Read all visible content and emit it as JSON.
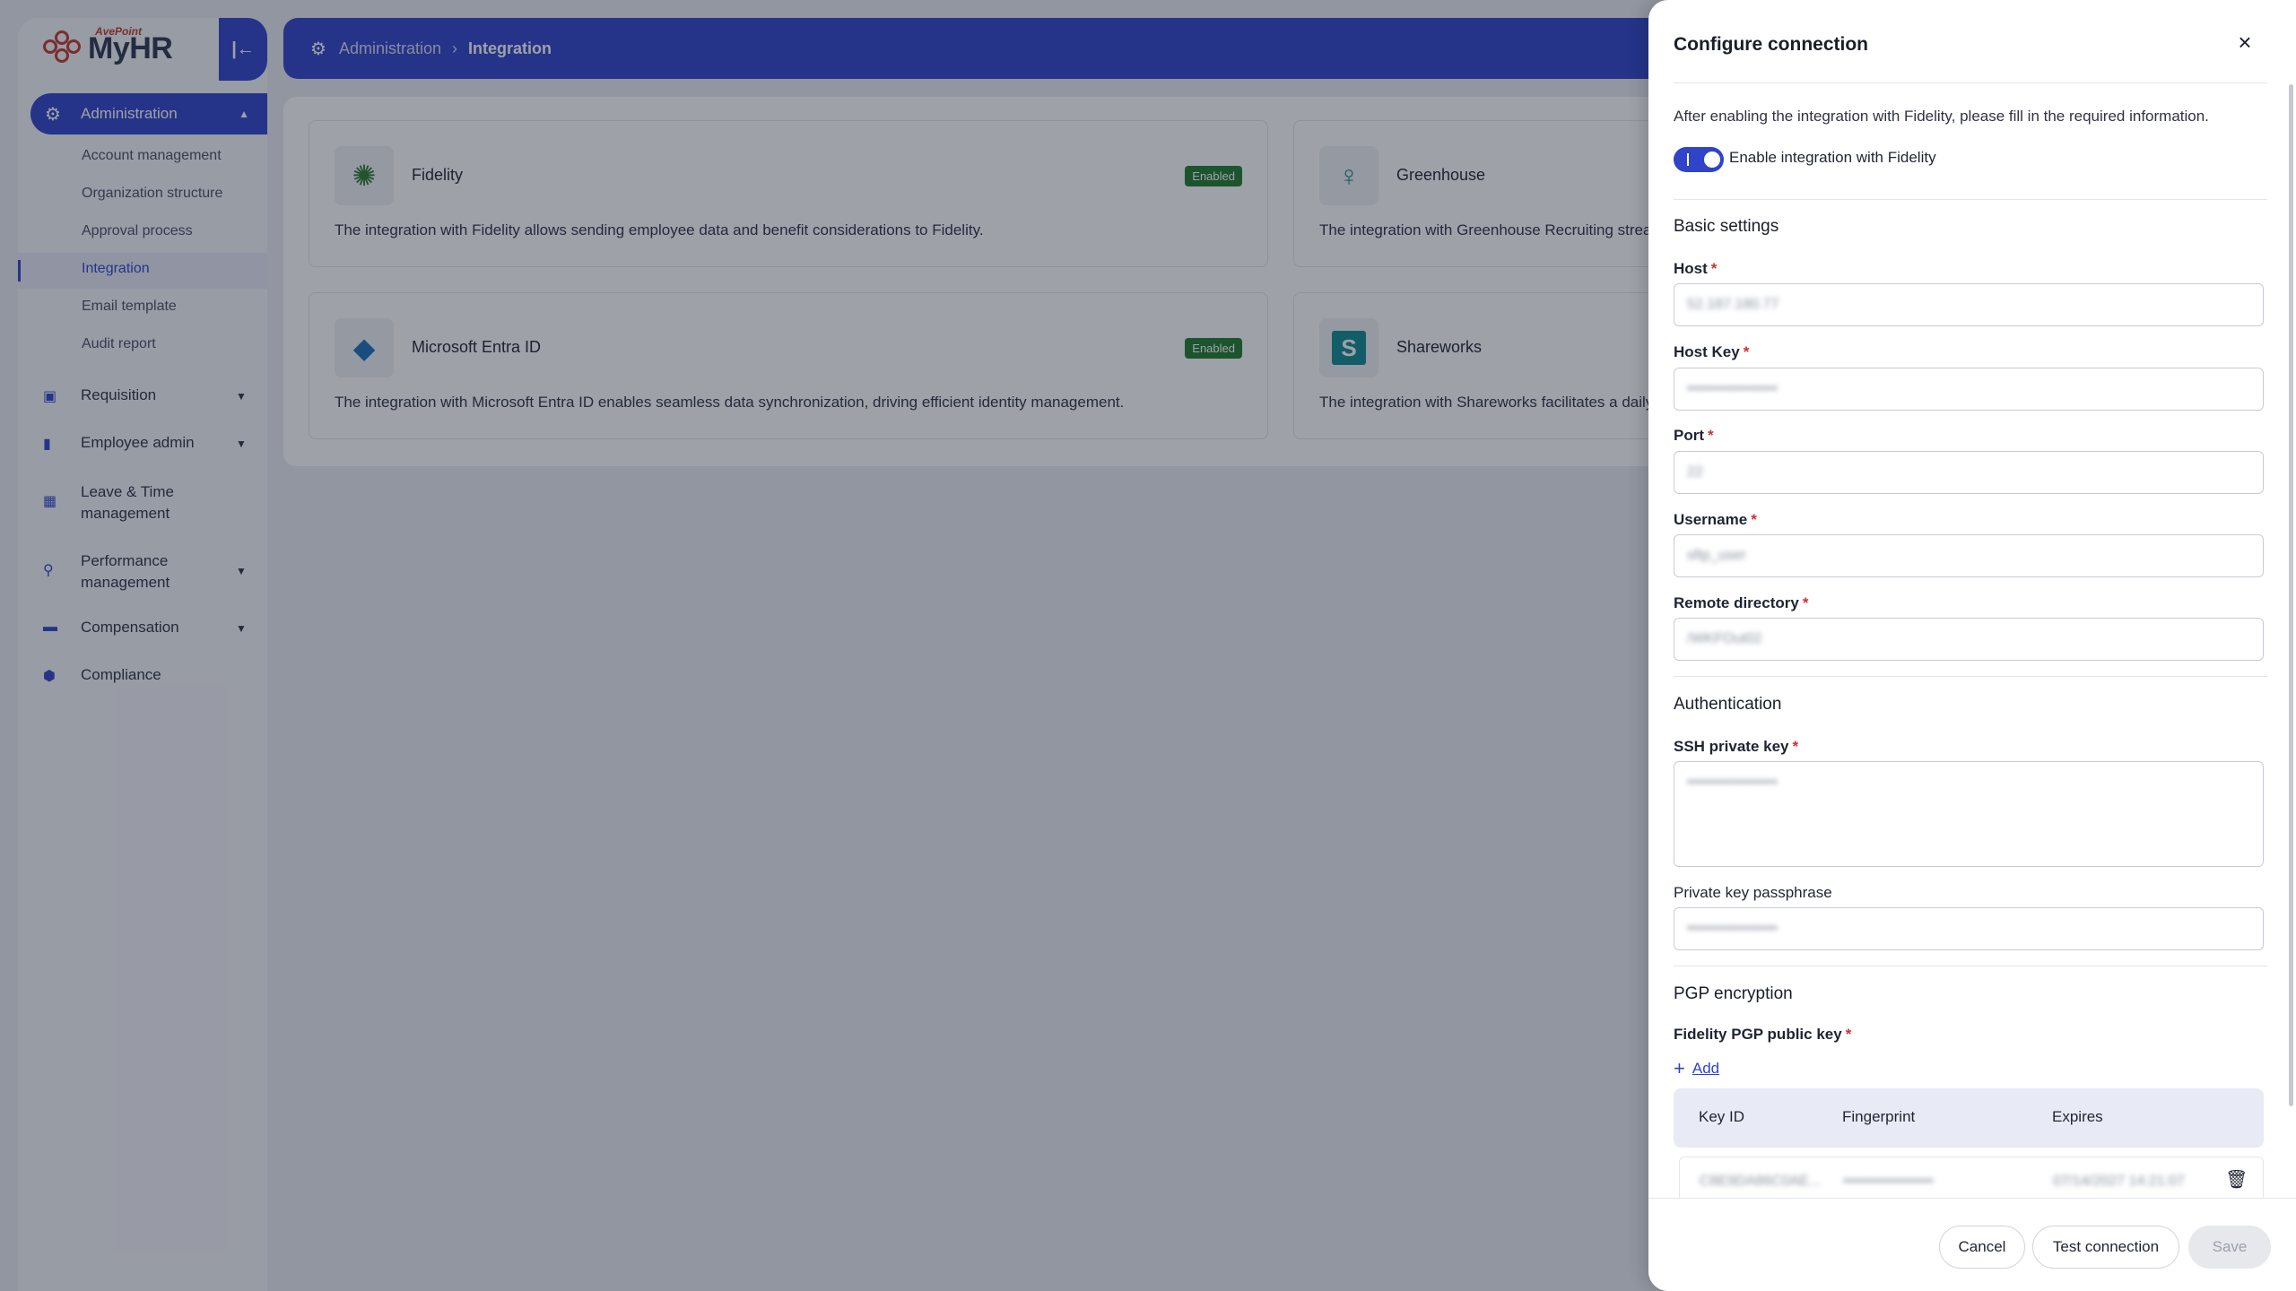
{
  "app": {
    "brand_sub": "AvePoint",
    "brand": "MyHR"
  },
  "sidebar": {
    "active_section": "Administration",
    "sub_items": [
      "Account management",
      "Organization structure",
      "Approval process",
      "Integration",
      "Email template",
      "Audit report"
    ],
    "items": [
      {
        "label": "Requisition"
      },
      {
        "label": "Employee admin"
      },
      {
        "label": "Leave & Time management"
      },
      {
        "label": "Performance management"
      },
      {
        "label": "Compensation"
      },
      {
        "label": "Compliance"
      }
    ]
  },
  "breadcrumb": {
    "root": "Administration",
    "current": "Integration"
  },
  "integrations": [
    {
      "name": "Fidelity",
      "badge": "Enabled",
      "desc": "The integration with Fidelity allows sending employee data and benefit considerations to Fidelity."
    },
    {
      "name": "Greenhouse",
      "desc": "The integration with Greenhouse Recruiting strea"
    },
    {
      "name": "Microsoft Entra ID",
      "badge": "Enabled",
      "desc": "The integration with Microsoft Entra ID enables seamless data synchronization, driving efficient identity management."
    },
    {
      "name": "Shareworks",
      "desc": "The integration with Shareworks facilitates a daily"
    }
  ],
  "drawer": {
    "title": "Configure connection",
    "close_icon": "×",
    "intro": "After enabling the integration with Fidelity, please fill in the required information.",
    "toggle_label": "Enable integration with Fidelity",
    "toggle_on": true,
    "basic_settings": "Basic settings",
    "host_label": "Host",
    "host_value": "52.187.180.77",
    "host_key_label": "Host Key",
    "host_key_value": "••••••••••••••••••",
    "port_label": "Port",
    "port_value": "22",
    "username_label": "Username",
    "username_value": "sftp_user",
    "remote_dir_label": "Remote directory",
    "remote_dir_value": "/WKFOut02",
    "authentication": "Authentication",
    "ssh_key_label": "SSH private key",
    "ssh_key_value": "••••••••••••••••••",
    "passphrase_label": "Private key passphrase",
    "passphrase_value": "••••••••••••••••••",
    "pgp_section": "PGP encryption",
    "pgp_key_label": "Fidelity PGP public key",
    "add_label": "Add",
    "key_table": {
      "columns": [
        "Key ID",
        "Fingerprint",
        "Expires"
      ],
      "rows": [
        {
          "key_id": "C8E9DA86C0AE...",
          "fingerprint": "••••••••••••••••••",
          "expires": "07/14/2027 14:21:07"
        }
      ]
    },
    "buttons": {
      "cancel": "Cancel",
      "test": "Test connection",
      "save": "Save"
    }
  },
  "colors": {
    "primary": "#2f44c8",
    "enabled_badge": "#1f7a2e",
    "required": "#d03030"
  }
}
